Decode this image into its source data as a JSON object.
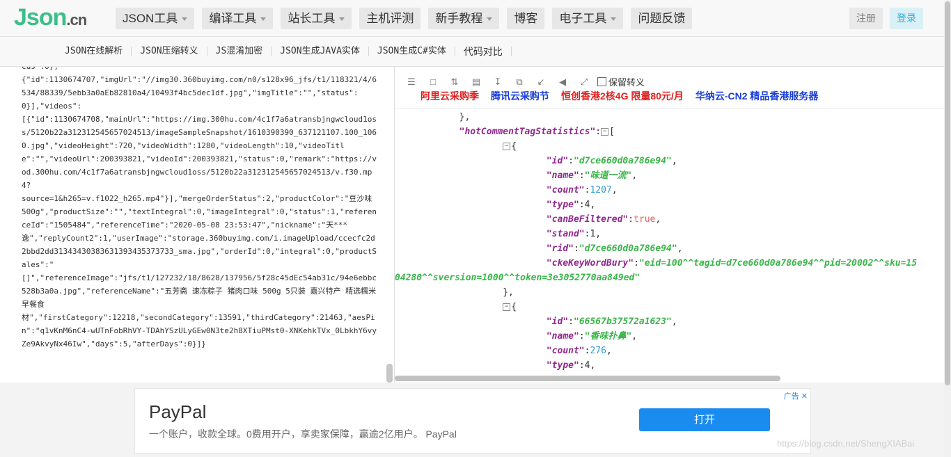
{
  "logo": {
    "main": "Json",
    "suffix": ".cn"
  },
  "nav": [
    {
      "label": "JSON工具",
      "dropdown": true
    },
    {
      "label": "编译工具",
      "dropdown": true
    },
    {
      "label": "站长工具",
      "dropdown": true
    },
    {
      "label": "主机评测",
      "dropdown": false
    },
    {
      "label": "新手教程",
      "dropdown": true
    },
    {
      "label": "博客",
      "dropdown": false
    },
    {
      "label": "电子工具",
      "dropdown": true
    },
    {
      "label": "问题反馈",
      "dropdown": false
    }
  ],
  "auth": {
    "register": "注册",
    "login": "登录"
  },
  "subnav": [
    "JSON在线解析",
    "JSON压缩转义",
    "JS混淆加密",
    "JSON生成JAVA实体",
    "JSON生成C#实体",
    "代码对比"
  ],
  "raw_json": "cus :0},\n{\"id\":1130674707,\"imgUrl\":\"//img30.360buyimg.com/n0/s128x96_jfs/t1/118321/4/6534/88339/5ebb3a0aEb82810a4/10493f4bc5dec1df.jpg\",\"imgTitle\":\"\",\"status\":0}],\"videos\":\n[{\"id\":1130674708,\"mainUrl\":\"https://img.300hu.com/4c1f7a6atransbjngwcloud1oss/5120b22a312312545657024513/imageSampleSnapshot/1610390390_637121107.100_1060.jpg\",\"videoHeight\":720,\"videoWidth\":1280,\"videoLength\":10,\"videoTitle\":\"\",\"videoUrl\":200393821,\"videoId\":200393821,\"status\":0,\"remark\":\"https://vod.300hu.com/4c1f7a6atransbjngwcloud1oss/5120b22a312312545657024513/v.f30.mp4?\nsource=1&h265=v.f1022_h265.mp4\"}],\"mergeOrderStatus\":2,\"productColor\":\"豆沙味\n500g\",\"productSize\":\"\",\"textIntegral\":0,\"imageIntegral\":0,\"status\":1,\"referenceId\":\"1505484\",\"referenceTime\":\"2020-05-08 23:53:47\",\"nickname\":\"天***\n逸\",\"replyCount2\":1,\"userImage\":\"storage.360buyimg.com/i.imageUpload/ccecfc2d2bbd2dd31343430383631393435373733_sma.jpg\",\"orderId\":0,\"integral\":0,\"productSales\":\"\n[]\",\"referenceImage\":\"jfs/t1/127232/18/8628/137956/5f28c45dEc54ab31c/94e6ebbc528b3a0a.jpg\",\"referenceName\":\"五芳斋 速冻粽子 猪肉口味 500g 5只装 嘉兴特产 精选糯米 早餐食\n材\",\"firstCategory\":12218,\"secondCategory\":13591,\"thirdCategory\":21463,\"aesPin\":\"q1vKnM6nC4-wUTnFobRhVY-TDAhYSzULyGEw0N3te2h8XTiuPMst0-XNKehkTVx_0LbkhY6vyZe9AkvyNx46Iw\",\"days\":5,\"afterDays\":0}]}",
  "toolbar": {
    "icons": [
      "database-icon",
      "file-icon",
      "sort-icon",
      "trash-icon",
      "download-icon",
      "copy-icon",
      "compress-icon",
      "share-icon",
      "expand-icon"
    ],
    "keep_escape_label": "保留转义"
  },
  "ads_links": [
    "阿里云采购季",
    "腾讯云采购节",
    "恒创香港2核4G 限量80元/月",
    "华纳云-CN2 精品香港服务器"
  ],
  "tree": {
    "close_prev": "},",
    "key_hot": "hotCommentTagStatistics",
    "item1": {
      "id": "d7ce660d0a786e94",
      "name": "味道一流",
      "count": "1207",
      "type": "4",
      "canBeFiltered": "true",
      "stand": "1",
      "rid": "d7ce660d0a786e94",
      "ckeKeyWordBury_a": "eid=100^^tagid=d7ce660d0a786e94^^pid=20002^^sku=15",
      "ckeKeyWordBury_b": "04280^^sversion=1000^^token=3e3052770aa849ed"
    },
    "item2": {
      "id": "66567b37572a1623",
      "name": "香味扑鼻",
      "count": "276",
      "type": "4"
    }
  },
  "bottom_ad": {
    "title": "PayPal",
    "desc": "一个账户，收款全球。0费用开户，享卖家保障，赢逾2亿用户。 PayPal",
    "button": "打开",
    "tag": "广告"
  },
  "watermark": "https://blog.csdn.net/ShengXIABai"
}
